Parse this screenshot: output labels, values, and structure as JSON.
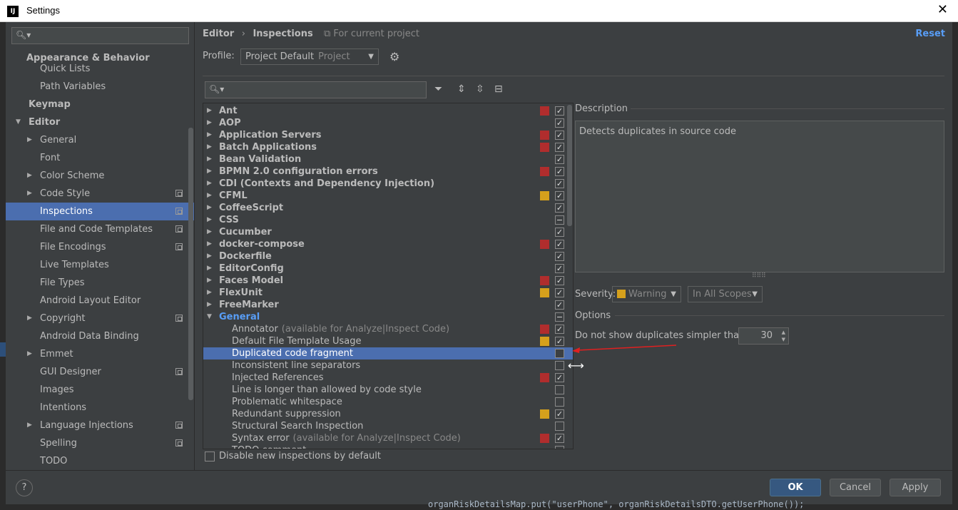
{
  "window": {
    "title": "Settings",
    "logo": "IJ"
  },
  "sidebar": {
    "items": [
      {
        "label": "Appearance & Behavior",
        "level": 0,
        "bold": true
      },
      {
        "label": "Quick Lists",
        "level": 1
      },
      {
        "label": "Path Variables",
        "level": 1
      },
      {
        "label": "Keymap",
        "level": 0,
        "bold": true
      },
      {
        "label": "Editor",
        "level": 0,
        "bold": true,
        "expanded": true
      },
      {
        "label": "General",
        "level": 1,
        "arrow": true
      },
      {
        "label": "Font",
        "level": 1
      },
      {
        "label": "Color Scheme",
        "level": 1,
        "arrow": true
      },
      {
        "label": "Code Style",
        "level": 1,
        "arrow": true,
        "project_icon": true
      },
      {
        "label": "Inspections",
        "level": 1,
        "selected": true,
        "project_icon": true
      },
      {
        "label": "File and Code Templates",
        "level": 1,
        "project_icon": true
      },
      {
        "label": "File Encodings",
        "level": 1,
        "project_icon": true
      },
      {
        "label": "Live Templates",
        "level": 1
      },
      {
        "label": "File Types",
        "level": 1
      },
      {
        "label": "Android Layout Editor",
        "level": 1
      },
      {
        "label": "Copyright",
        "level": 1,
        "arrow": true,
        "project_icon": true
      },
      {
        "label": "Android Data Binding",
        "level": 1
      },
      {
        "label": "Emmet",
        "level": 1,
        "arrow": true
      },
      {
        "label": "GUI Designer",
        "level": 1,
        "project_icon": true
      },
      {
        "label": "Images",
        "level": 1
      },
      {
        "label": "Intentions",
        "level": 1
      },
      {
        "label": "Language Injections",
        "level": 1,
        "arrow": true,
        "project_icon": true
      },
      {
        "label": "Spelling",
        "level": 1,
        "project_icon": true
      },
      {
        "label": "TODO",
        "level": 1
      }
    ]
  },
  "header": {
    "breadcrumb": [
      "Editor",
      "Inspections"
    ],
    "separator": "›",
    "scope_note": "For current project",
    "reset": "Reset"
  },
  "profile": {
    "label": "Profile:",
    "value": "Project Default",
    "scope": "Project"
  },
  "inspections": [
    {
      "label": "Ant",
      "type": "cat",
      "sev": "error",
      "check": "checked"
    },
    {
      "label": "AOP",
      "type": "cat",
      "sev": "",
      "check": "checked"
    },
    {
      "label": "Application Servers",
      "type": "cat",
      "sev": "error",
      "check": "checked"
    },
    {
      "label": "Batch Applications",
      "type": "cat",
      "sev": "error",
      "check": "checked"
    },
    {
      "label": "Bean Validation",
      "type": "cat",
      "sev": "",
      "check": "checked"
    },
    {
      "label": "BPMN 2.0 configuration errors",
      "type": "cat",
      "sev": "error",
      "check": "checked"
    },
    {
      "label": "CDI (Contexts and Dependency Injection)",
      "type": "cat",
      "sev": "",
      "check": "checked"
    },
    {
      "label": "CFML",
      "type": "cat",
      "sev": "warning",
      "check": "checked"
    },
    {
      "label": "CoffeeScript",
      "type": "cat",
      "sev": "",
      "check": "checked"
    },
    {
      "label": "CSS",
      "type": "cat",
      "sev": "",
      "check": "partial"
    },
    {
      "label": "Cucumber",
      "type": "cat",
      "sev": "",
      "check": "checked"
    },
    {
      "label": "docker-compose",
      "type": "cat",
      "sev": "error",
      "check": "checked"
    },
    {
      "label": "Dockerfile",
      "type": "cat",
      "sev": "",
      "check": "checked"
    },
    {
      "label": "EditorConfig",
      "type": "cat",
      "sev": "",
      "check": "checked"
    },
    {
      "label": "Faces Model",
      "type": "cat",
      "sev": "error",
      "check": "checked"
    },
    {
      "label": "FlexUnit",
      "type": "cat",
      "sev": "warning",
      "check": "checked"
    },
    {
      "label": "FreeMarker",
      "type": "cat",
      "sev": "",
      "check": "checked"
    },
    {
      "label": "General",
      "type": "cat-open",
      "sev": "",
      "check": "partial"
    },
    {
      "label": "Annotator",
      "note": "(available for Analyze|Inspect Code)",
      "type": "child",
      "sev": "error",
      "check": "checked"
    },
    {
      "label": "Default File Template Usage",
      "type": "child",
      "sev": "warning",
      "check": "checked"
    },
    {
      "label": "Duplicated code fragment",
      "type": "child",
      "sev": "",
      "check": "unchecked",
      "selected": true
    },
    {
      "label": "Inconsistent line separators",
      "type": "child",
      "sev": "",
      "check": "unchecked"
    },
    {
      "label": "Injected References",
      "type": "child",
      "sev": "error",
      "check": "checked"
    },
    {
      "label": "Line is longer than allowed by code style",
      "type": "child",
      "sev": "",
      "check": "unchecked"
    },
    {
      "label": "Problematic whitespace",
      "type": "child",
      "sev": "",
      "check": "unchecked"
    },
    {
      "label": "Redundant suppression",
      "type": "child",
      "sev": "warning",
      "check": "checked"
    },
    {
      "label": "Structural Search Inspection",
      "type": "child",
      "sev": "",
      "check": "unchecked"
    },
    {
      "label": "Syntax error",
      "note": "(available for Analyze|Inspect Code)",
      "type": "child",
      "sev": "error",
      "check": "checked"
    },
    {
      "label": "TODO comment",
      "type": "child",
      "sev": "",
      "check": "unchecked"
    }
  ],
  "colors": {
    "error": "#b02d2d",
    "warning": "#d5a01c",
    "selection": "#4b6eaf",
    "link": "#589df6"
  },
  "disable_new": "Disable new inspections by default",
  "description": {
    "label": "Description",
    "text": "Detects duplicates in source code"
  },
  "severity": {
    "label": "Severity:",
    "value": "Warning",
    "scope": "In All Scopes"
  },
  "options": {
    "label": "Options",
    "dup_label": "Do not show duplicates simpler than:",
    "dup_value": "30"
  },
  "buttons": {
    "help": "?",
    "ok": "OK",
    "cancel": "Cancel",
    "apply": "Apply"
  },
  "background_code": "organRiskDetailsMap.put(\"userPhone\", organRiskDetailsDTO.getUserPhone());"
}
